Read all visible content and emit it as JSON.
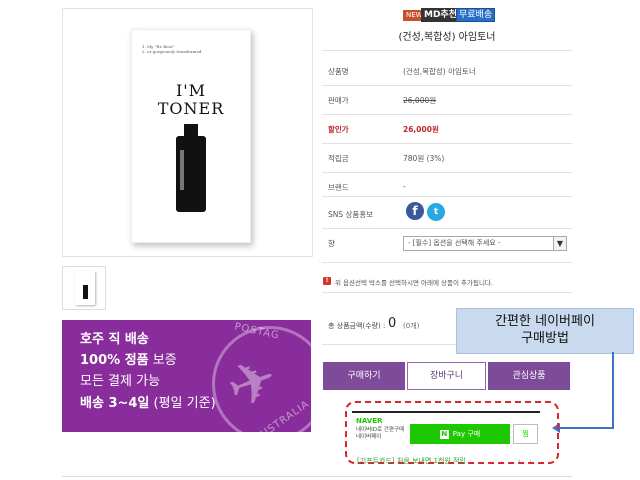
{
  "product_image": {
    "box_small_text": "1. My \"Re Boot\"\n2. or gorgeously transformed",
    "box_title_line1": "I'M",
    "box_title_line2": "TONER"
  },
  "banner": {
    "line1": "호주 직 배송",
    "line2_bold": "100% 정품",
    "line2_rest": " 보증",
    "line3": "모든 결제 가능",
    "line4_bold": "배송 3~4일",
    "line4_rest": " (평일 기준)",
    "stamp_top": "POSTAG",
    "stamp_bottom": "AUSTRALIA"
  },
  "badges": {
    "new": "NEW",
    "md": "MD추천",
    "free": "무료배송"
  },
  "product": {
    "title": "(건성,복합성) 아임토너",
    "rows": [
      {
        "label": "상품명",
        "value": "(건성,복합성) 아임토너"
      },
      {
        "label": "판매가",
        "value": "26,000원"
      },
      {
        "label": "할인가",
        "value": "26,000원"
      },
      {
        "label": "적립금",
        "value": "780원 (3%)"
      },
      {
        "label": "브랜드",
        "value": "-"
      },
      {
        "label": "SNS 상품홍보",
        "value": ""
      },
      {
        "label": "향",
        "value": ""
      }
    ],
    "option_placeholder": "- [필수] 옵션을 선택해 주세요 -",
    "notice": "위 옵션선택 박스를 선택하시면 아래에 상품이 추가됩니다.",
    "total_label": "총 상품금액(수량) :",
    "total_value": "0",
    "total_unit": "(0개)"
  },
  "buttons": {
    "buy": "구매하기",
    "cart": "장바구니",
    "wish": "관심상품"
  },
  "callout": {
    "line1": "간편한 네이버페이",
    "line2": "구매방법"
  },
  "naverpay": {
    "logo": "NAVER",
    "desc": "네이버ID로 간편구매\n네이버페이",
    "pay_label": "Pay 구매",
    "pay_icon": "N",
    "wish_label": "찜",
    "promo": "[기프트카드] 처음 보내면 1천원 적립",
    "prev": "‹",
    "next": "›"
  },
  "colors": {
    "purple": "#7d4b98",
    "banner_bg": "#8a2d9c",
    "naver_green": "#1ec800",
    "sale_red": "#c0262c",
    "callout_bg": "#c9d9ee",
    "arrow_blue": "#3c73c4"
  }
}
